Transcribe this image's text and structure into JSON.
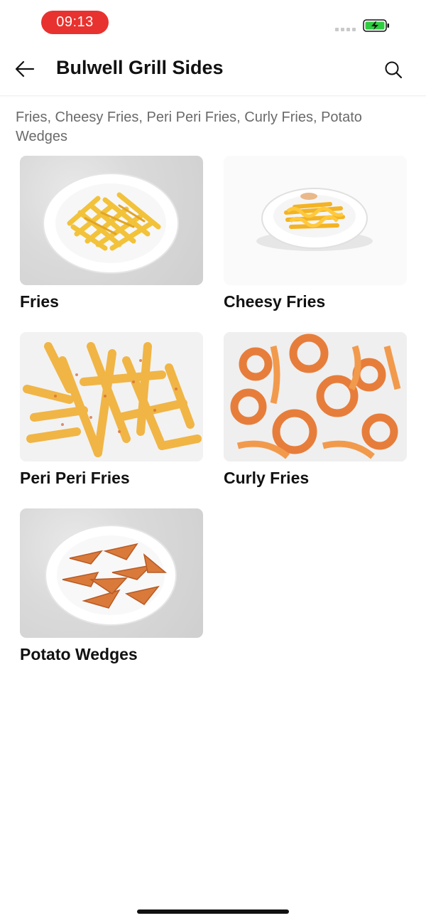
{
  "status_bar": {
    "time": "09:13",
    "icons": [
      "signal-icon",
      "battery-charging-icon"
    ],
    "colors": {
      "time_pill": "#e8322f",
      "battery": "#2ecc40"
    }
  },
  "header": {
    "title": "Bulwell Grill Sides",
    "back_icon": "back-arrow-icon",
    "search_icon": "search-icon"
  },
  "subtitle": "Fries, Cheesy Fries, Peri Peri Fries, Curly Fries, Potato Wedges",
  "items": [
    {
      "name": "Fries",
      "image": "fries-image"
    },
    {
      "name": "Cheesy Fries",
      "image": "cheesy-fries-image"
    },
    {
      "name": "Peri Peri Fries",
      "image": "peri-peri-fries-image"
    },
    {
      "name": "Curly Fries",
      "image": "curly-fries-image"
    },
    {
      "name": "Potato Wedges",
      "image": "potato-wedges-image"
    }
  ]
}
